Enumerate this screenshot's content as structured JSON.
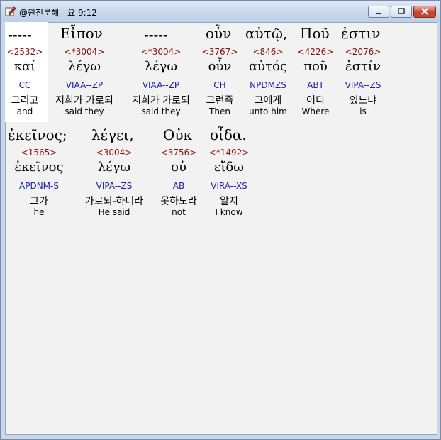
{
  "window": {
    "title": "@원전분해 - 요 9:12"
  },
  "rows": [
    [
      {
        "greek": "-----",
        "strong": "<2532>",
        "lemma": "καί",
        "parse": "CC",
        "korean": "그리고",
        "english": "and"
      },
      {
        "greek": "Εἶπον",
        "strong": "<*3004>",
        "lemma": "λέγω",
        "parse": "VIAA--ZP",
        "korean": "저희가 가로되",
        "english": "said they"
      },
      {
        "greek": "-----",
        "strong": "<*3004>",
        "lemma": "λέγω",
        "parse": "VIAA--ZP",
        "korean": "저희가 가로되",
        "english": "said they"
      },
      {
        "greek": "οὖν",
        "strong": "<3767>",
        "lemma": "οὖν",
        "parse": "CH",
        "korean": "그런즉",
        "english": "Then"
      },
      {
        "greek": "αὐτῷ,",
        "strong": "<846>",
        "lemma": "αὐτός",
        "parse": "NPDMZS",
        "korean": "그에게",
        "english": "unto him"
      },
      {
        "greek": "Ποῦ",
        "strong": "<4226>",
        "lemma": "ποῦ",
        "parse": "ABT",
        "korean": "어디",
        "english": "Where"
      },
      {
        "greek": "ἐστιν",
        "strong": "<2076>",
        "lemma": "ἐστίν",
        "parse": "VIPA--ZS",
        "korean": "있느냐",
        "english": "is"
      }
    ],
    [
      {
        "greek": "ἐκεῖνος;",
        "strong": "<1565>",
        "lemma": "ἐκεῖνος",
        "parse": "APDNM-S",
        "korean": "그가",
        "english": "he"
      },
      {
        "greek": "λέγει,",
        "strong": "<3004>",
        "lemma": "λέγω",
        "parse": "VIPA--ZS",
        "korean": "가로되-하니라",
        "english": "He said"
      },
      {
        "greek": "Οὐκ",
        "strong": "<3756>",
        "lemma": "οὐ",
        "parse": "AB",
        "korean": "못하노라",
        "english": "not"
      },
      {
        "greek": "οἶδα.",
        "strong": "<*1492>",
        "lemma": "εἴδω",
        "parse": "VIRA--XS",
        "korean": "알지",
        "english": "I know"
      }
    ]
  ]
}
